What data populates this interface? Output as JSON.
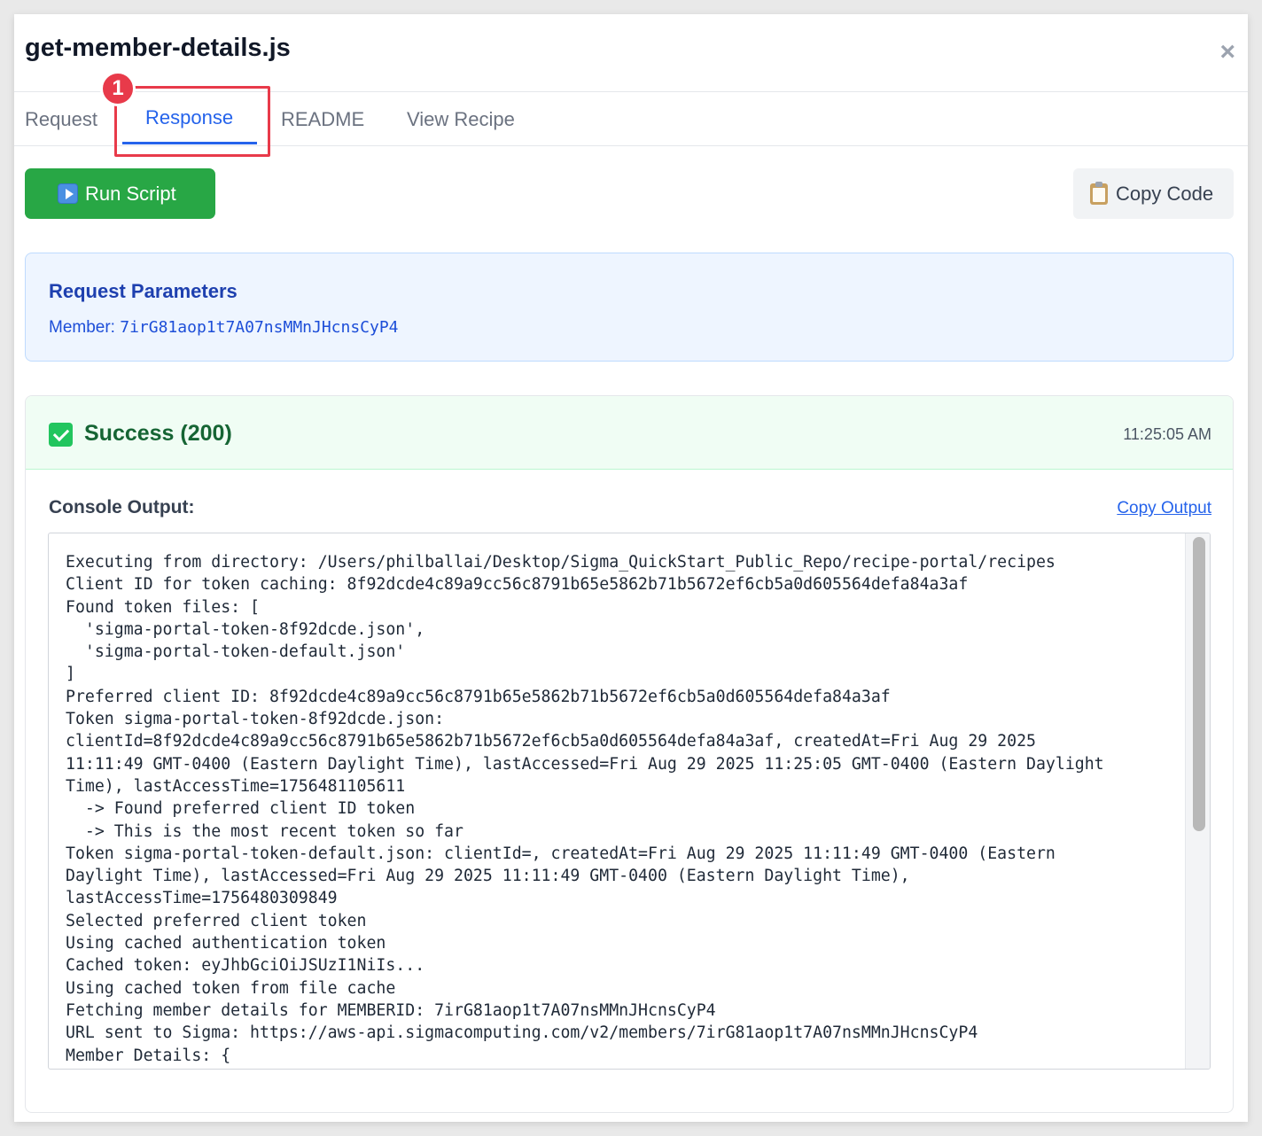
{
  "modal": {
    "title": "get-member-details.js",
    "close_label": "×"
  },
  "tabs": [
    {
      "label": "Request",
      "active": false
    },
    {
      "label": "Response",
      "active": true
    },
    {
      "label": "README",
      "active": false
    },
    {
      "label": "View Recipe",
      "active": false
    }
  ],
  "callout": {
    "number": "1",
    "color": "#e83a4a"
  },
  "toolbar": {
    "run_label": "Run Script",
    "run_icon": "play-button-icon",
    "copy_label": "Copy Code",
    "copy_icon": "clipboard-icon"
  },
  "params": {
    "title": "Request Parameters",
    "member_label": "Member: ",
    "member_value": "7irG81aop1t7A07nsMMnJHcnsCyP4"
  },
  "result": {
    "status": "Success (200)",
    "status_icon": "check-icon",
    "time": "11:25:05 AM",
    "console_label": "Console Output:",
    "copy_output_label": "Copy Output",
    "console_lines": [
      "Executing from directory: /Users/philballai/Desktop/Sigma_QuickStart_Public_Repo/recipe-portal/recipes",
      "Client ID for token caching: 8f92dcde4c89a9cc56c8791b65e5862b71b5672ef6cb5a0d605564defa84a3af",
      "Found token files: [",
      "  'sigma-portal-token-8f92dcde.json',",
      "  'sigma-portal-token-default.json'",
      "]",
      "Preferred client ID: 8f92dcde4c89a9cc56c8791b65e5862b71b5672ef6cb5a0d605564defa84a3af",
      "Token sigma-portal-token-8f92dcde.json:",
      "clientId=8f92dcde4c89a9cc56c8791b65e5862b71b5672ef6cb5a0d605564defa84a3af, createdAt=Fri Aug 29 2025",
      "11:11:49 GMT-0400 (Eastern Daylight Time), lastAccessed=Fri Aug 29 2025 11:25:05 GMT-0400 (Eastern Daylight",
      "Time), lastAccessTime=1756481105611",
      "  -> Found preferred client ID token",
      "  -> This is the most recent token so far",
      "Token sigma-portal-token-default.json: clientId=, createdAt=Fri Aug 29 2025 11:11:49 GMT-0400 (Eastern",
      "Daylight Time), lastAccessed=Fri Aug 29 2025 11:11:49 GMT-0400 (Eastern Daylight Time),",
      "lastAccessTime=1756480309849",
      "Selected preferred client token",
      "Using cached authentication token",
      "Cached token: eyJhbGciOiJSUzI1NiIs...",
      "Using cached token from file cache",
      "Fetching member details for MEMBERID: 7irG81aop1t7A07nsMMnJHcnsCyP4",
      "URL sent to Sigma: https://aws-api.sigmacomputing.com/v2/members/7irG81aop1t7A07nsMMnJHcnsCyP4",
      "Member Details: {"
    ]
  },
  "colors": {
    "accent": "#2563eb",
    "run_button": "#28a745",
    "success_bg": "#f0fdf4",
    "params_bg": "#eef5ff"
  }
}
